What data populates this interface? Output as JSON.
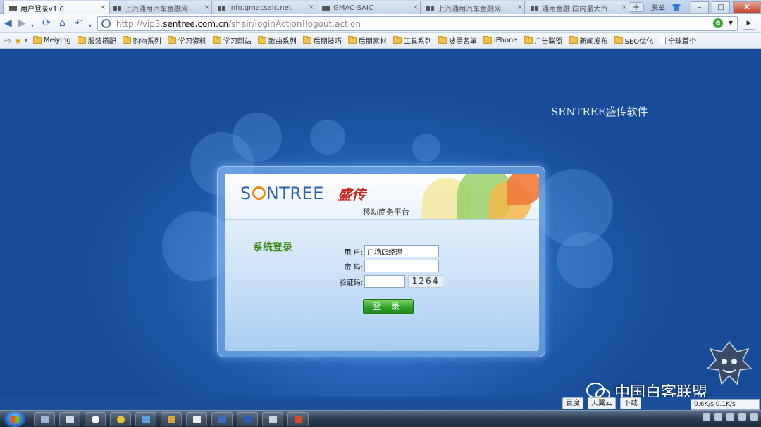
{
  "browser": {
    "tabs": [
      {
        "title": "用户登录v1.0",
        "active": true
      },
      {
        "title": "上汽通用汽车金融网上订(x",
        "active": false
      },
      {
        "title": "info.gmacsaic.net",
        "active": false
      },
      {
        "title": "GMAC-SAIC",
        "active": false
      },
      {
        "title": "上汽通用汽车金融网上订",
        "active": false
      },
      {
        "title": "通用金融|国内最大汽车金",
        "active": false
      }
    ],
    "new_tab_label": "+",
    "top_right_text": "原单",
    "window_buttons": {
      "minimize": "–",
      "maximize": "□",
      "close": "X"
    },
    "url_prefix": "http://vip3.",
    "url_domain": "sentree.com.cn",
    "url_path": "/shair/loginAction!logout.action",
    "engine_icon_text": "e",
    "bookmarks": [
      {
        "label": "Meiying",
        "icon": "folder-icon"
      },
      {
        "label": "服装搭配",
        "icon": "folder-icon"
      },
      {
        "label": "购物系列",
        "icon": "folder-icon"
      },
      {
        "label": "学习资料",
        "icon": "folder-icon"
      },
      {
        "label": "学习网站",
        "icon": "folder-icon"
      },
      {
        "label": "歌曲系列",
        "icon": "folder-icon"
      },
      {
        "label": "后期技巧",
        "icon": "folder-icon"
      },
      {
        "label": "后期素材",
        "icon": "folder-icon"
      },
      {
        "label": "工具系列",
        "icon": "folder-icon"
      },
      {
        "label": "被黑名单",
        "icon": "folder-icon"
      },
      {
        "label": "iPhone",
        "icon": "folder-icon"
      },
      {
        "label": "广告联盟",
        "icon": "folder-icon"
      },
      {
        "label": "新闻发布",
        "icon": "folder-icon"
      },
      {
        "label": "SEO优化",
        "icon": "folder-icon"
      },
      {
        "label": "全球首个",
        "icon": "page-icon"
      }
    ]
  },
  "page": {
    "brand_corner": "SENTREE盛传软件",
    "logo_text_before": "S",
    "logo_text_after": "NTREE",
    "logo_cn": "盛传",
    "logo_subtitle": "移动商务平台",
    "panel_title": "系统登录",
    "form": {
      "user_label": "用  户:",
      "user_value": "广场店经理",
      "password_label": "密  码:",
      "password_value": "",
      "captcha_label": "验证码:",
      "captcha_value": "",
      "captcha_image_text": "1264",
      "submit_label": "登 录"
    },
    "watermark_text": "中国白客联盟"
  },
  "overlay": {
    "float_buttons": [
      "百度",
      "天翼云",
      "下载"
    ],
    "speed_text": "0.6K/s  0.1K/s"
  },
  "colors": {
    "page_background": "#1d56a6",
    "accent_blue": "#2a62b3",
    "logo_orange": "#f08a10",
    "logo_red": "#c8281e",
    "title_green": "#3a8a1a",
    "button_green": "#2fa02a"
  }
}
